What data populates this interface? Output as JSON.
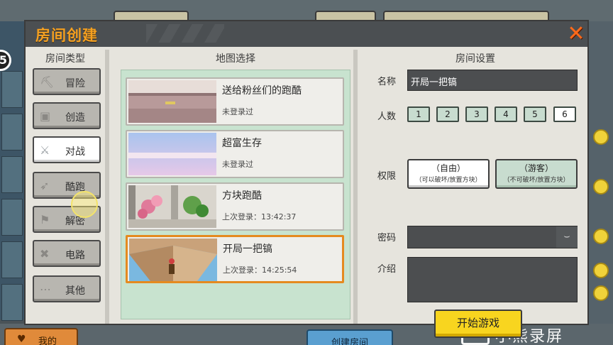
{
  "dialog": {
    "title": "房间创建",
    "close_glyph": "✕"
  },
  "room_types": {
    "title": "房间类型",
    "items": [
      {
        "label": "冒险",
        "icon": "pickaxe-icon",
        "active": false
      },
      {
        "label": "创造",
        "icon": "block-icon",
        "active": false
      },
      {
        "label": "对战",
        "icon": "crossed-swords-icon",
        "active": true
      },
      {
        "label": "酷跑",
        "icon": "running-shoe-icon",
        "active": false
      },
      {
        "label": "解密",
        "icon": "flag-icon",
        "active": false
      },
      {
        "label": "电路",
        "icon": "wrench-icon",
        "active": false
      },
      {
        "label": "其他",
        "icon": "dots-icon",
        "active": false
      }
    ]
  },
  "map_select": {
    "title": "地图选择",
    "maps": [
      {
        "name": "送给粉丝们的跑酷",
        "subtitle": "未登录过",
        "selected": false
      },
      {
        "name": "超富生存",
        "subtitle": "未登录过",
        "selected": false
      },
      {
        "name": "方块跑酷",
        "subtitle": "上次登录：13:42:37",
        "selected": false
      },
      {
        "name": "开局一把镐",
        "subtitle": "上次登录：14:25:54",
        "selected": true
      }
    ]
  },
  "settings": {
    "title": "房间设置",
    "name_label": "名称",
    "name_value": "开局一把镐",
    "players_label": "人数",
    "player_counts": [
      "1",
      "2",
      "3",
      "4",
      "5",
      "6"
    ],
    "selected_count": "6",
    "permission_label": "权限",
    "permissions": [
      {
        "main": "（自由）",
        "sub": "（可以破坏/放置方块）"
      },
      {
        "main": "（游客）",
        "sub": "（不可破坏/放置方块）"
      }
    ],
    "password_label": "密码",
    "intro_label": "介绍",
    "start_button": "开始游戏"
  },
  "background": {
    "favorites_button": "我的",
    "create_room_button": "创建房间",
    "watermark": "小熊录屏",
    "edge_badge": "5"
  },
  "colors": {
    "title_orange": "#f5a020",
    "selected_border": "#e58a1f",
    "start_yellow": "#f8d51f",
    "map_panel_green": "#c8e3cf"
  }
}
